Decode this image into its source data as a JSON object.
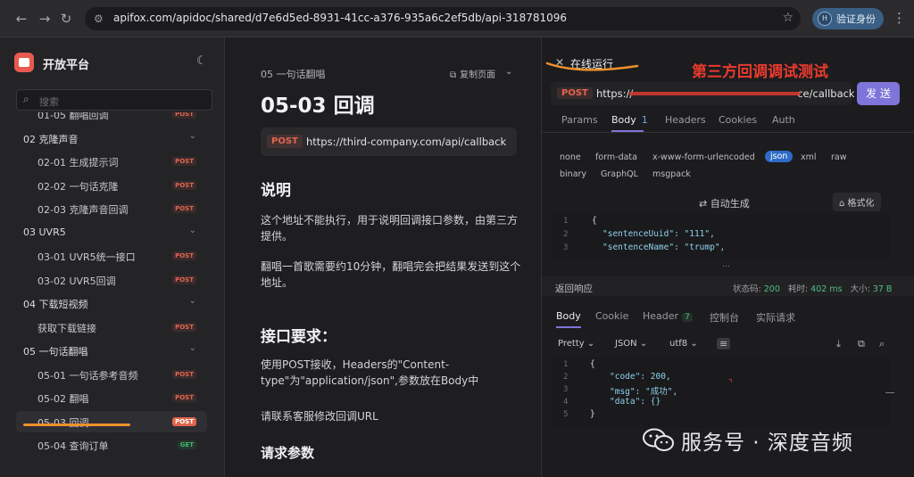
{
  "browser": {
    "url": "apifox.com/apidoc/shared/d7e6d5ed-8931-41cc-a376-935a6c2ef5db/api-318781096",
    "verify_label": "验证身份"
  },
  "sidebar": {
    "title": "开放平台",
    "search_placeholder": "搜索",
    "items": [
      {
        "label": "01-05 翻唱回调",
        "method": "POST",
        "level": "item"
      },
      {
        "label": "02 克隆声音",
        "level": "group"
      },
      {
        "label": "02-01 生成提示词",
        "method": "POST",
        "level": "item"
      },
      {
        "label": "02-02 一句话克隆",
        "method": "POST",
        "level": "item"
      },
      {
        "label": "02-03 克隆声音回调",
        "method": "POST",
        "level": "item"
      },
      {
        "label": "03 UVR5",
        "level": "group"
      },
      {
        "label": "03-01 UVR5统一接口",
        "method": "POST",
        "level": "item"
      },
      {
        "label": "03-02 UVR5回调",
        "method": "POST",
        "level": "item"
      },
      {
        "label": "04 下载短视频",
        "level": "group"
      },
      {
        "label": "获取下载链接",
        "method": "POST",
        "level": "item"
      },
      {
        "label": "05 一句话翻唱",
        "level": "group"
      },
      {
        "label": "05-01 一句话参考音频",
        "method": "POST",
        "level": "item"
      },
      {
        "label": "05-02 翻唱",
        "method": "POST",
        "level": "item"
      },
      {
        "label": "05-03 回调",
        "method": "POST",
        "level": "item",
        "active": true
      },
      {
        "label": "05-04 查询订单",
        "method": "GET",
        "level": "item"
      }
    ]
  },
  "doc": {
    "breadcrumb": "05 一句话翻唱",
    "copy_page": "复制页面",
    "title": "05-03 回调",
    "method": "POST",
    "url": "https://third-company.com/api/callback",
    "h_desc": "说明",
    "p1": "这个地址不能执行，用于说明回调接口参数，由第三方提供。",
    "p2": "翻唱一首歌需要约10分钟，翻唱完会把结果发送到这个地址。",
    "h_req": "接口要求：",
    "p3": "使用POST接收，Headers的\"Content-type\"为\"application/json\",参数放在Body中",
    "p4": "请联系客服修改回调URL",
    "h_params": "请求参数"
  },
  "right": {
    "title": "在线运行",
    "annotation": "第三方回调调试测试",
    "method": "POST",
    "url": "https://third-company.com/api/callback",
    "url_visible_head": "https://",
    "url_visible_tail": "ce/callback",
    "send": "发 送",
    "tabs": [
      {
        "label": "Params"
      },
      {
        "label": "Body",
        "count": "1",
        "active": true
      },
      {
        "label": "Headers"
      },
      {
        "label": "Cookies"
      },
      {
        "label": "Auth"
      }
    ],
    "body_types_row1": [
      "none",
      "form-data",
      "x-www-form-urlencoded",
      "json",
      "xml",
      "raw"
    ],
    "body_types_row2": [
      "binary",
      "GraphQL",
      "msgpack"
    ],
    "active_body_type": "json",
    "auto_generate": "自动生成",
    "format": "格式化",
    "request_lines": [
      "{",
      "\"sentenceUuid\": \"111\",",
      "\"sentenceName\": \"trump\","
    ],
    "response_title": "返回响应",
    "status_label": "状态码:",
    "status_value": "200",
    "time_label": "耗时:",
    "time_value": "402 ms",
    "size_label": "大小:",
    "size_value": "37 B",
    "resp_tabs": [
      {
        "label": "Body",
        "active": true
      },
      {
        "label": "Cookie"
      },
      {
        "label": "Header",
        "count": "7"
      },
      {
        "label": "控制台"
      },
      {
        "label": "实际请求"
      }
    ],
    "fmt_pretty": "Pretty",
    "fmt_json": "JSON",
    "fmt_utf8": "utf8",
    "response_lines": [
      "{",
      "\"code\": 200,",
      "\"msg\": \"成功\",",
      "\"data\": {}",
      "}"
    ]
  },
  "watermark": "服务号 · 深度音频",
  "colors": {
    "accent": "#7e74d9",
    "post": "#e0654e",
    "get": "#3fb56d",
    "annotation": "#ea3a2e"
  }
}
